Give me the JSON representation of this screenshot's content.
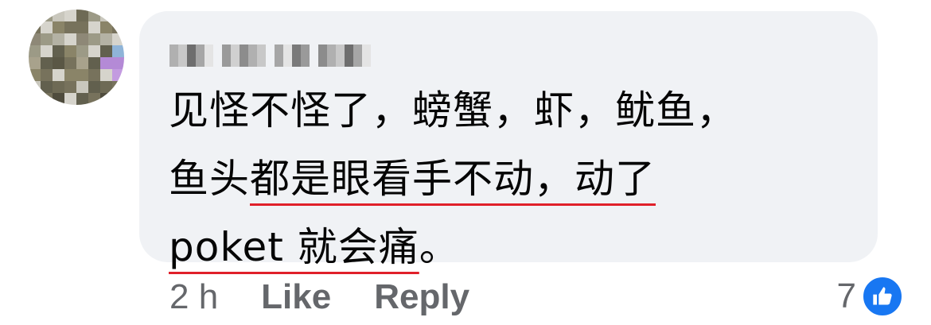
{
  "comment": {
    "author_name": "",
    "text_lines": [
      {
        "plain": "见怪不怪了，螃蟹，虾，鱿鱼，",
        "underlined": ""
      },
      {
        "plain": "鱼头",
        "underlined": "都是眼看手不动，动了"
      },
      {
        "plain": "",
        "underlined": "poket 就会痛",
        "tail": "。"
      }
    ]
  },
  "actions": {
    "time": "2 h",
    "like_label": "Like",
    "reply_label": "Reply"
  },
  "reactions": {
    "count": "7",
    "icon": "thumbs-up-icon",
    "color": "#1877f2"
  },
  "colors": {
    "bubble": "#f0f2f5",
    "underline": "#e0202a",
    "muted_text": "#65676b"
  }
}
